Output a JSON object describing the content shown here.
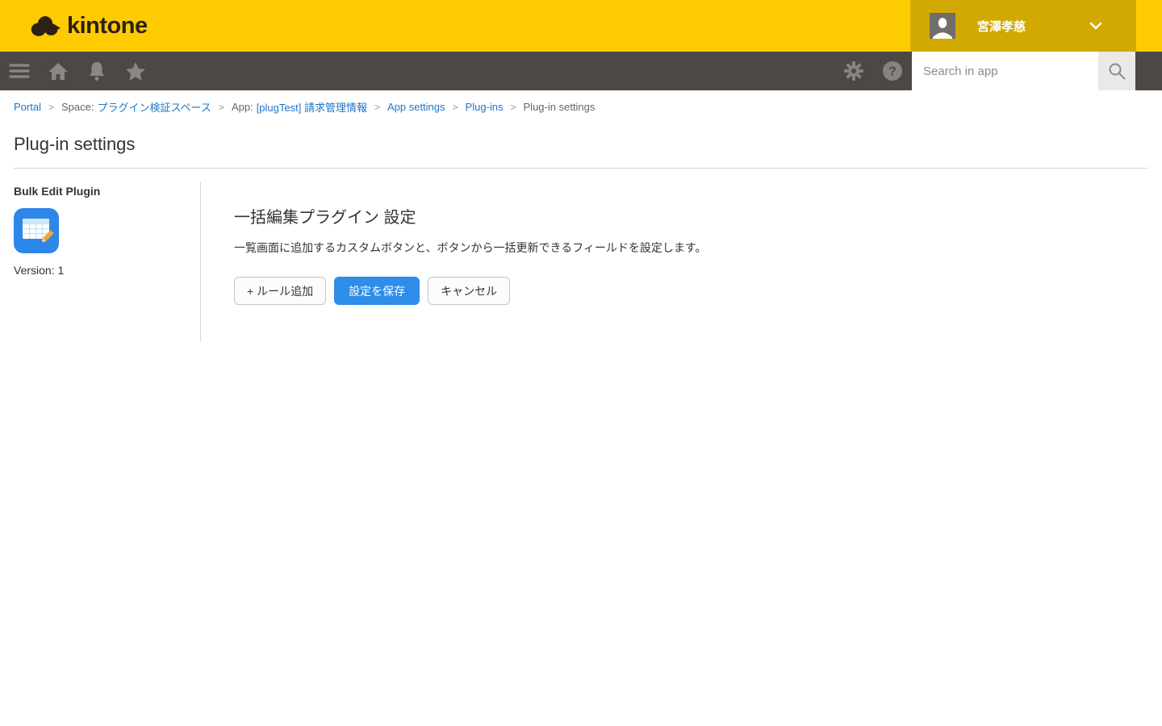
{
  "topbar": {
    "logo_text": "kintone",
    "user": {
      "name": "宮澤孝慈"
    }
  },
  "navbar": {
    "search_placeholder": "Search in app"
  },
  "breadcrumb": {
    "separator": ">",
    "portal": "Portal",
    "space_prefix": "Space:",
    "space_link": "プラグイン検証スペース",
    "app_prefix": "App:",
    "app_link": "[plugTest] 請求管理情報",
    "app_settings": "App settings",
    "plugins": "Plug-ins",
    "current": "Plug-in settings"
  },
  "page": {
    "title": "Plug-in settings"
  },
  "sidebar": {
    "plugin_name": "Bulk Edit Plugin",
    "version": "Version: 1"
  },
  "main": {
    "heading": "一括編集プラグイン 設定",
    "description": "一覧画面に追加するカスタムボタンと、ボタンから一括更新できるフィールドを設定します。",
    "buttons": {
      "add_rule": "+ ルール追加",
      "save": "設定を保存",
      "cancel": "キャンセル"
    }
  },
  "icons": {
    "logo_mark": "cloud",
    "hamburger": "≡",
    "home": "⌂",
    "bell": "🔔",
    "star": "★",
    "gear": "⚙",
    "help": "?",
    "search": "🔍",
    "chevron_down": "⌄",
    "avatar_person": "👤",
    "plugin_mark": "table-with-pencil"
  },
  "colors": {
    "brand_yellow": "#FDCB00",
    "user_area_gold": "#D2A900",
    "navbar_gray": "#4B4845",
    "nav_icon_gray": "#8B8783",
    "primary_blue": "#2D8DE8",
    "link_blue": "#2077C8",
    "divider_gray": "#D5D5D5"
  }
}
